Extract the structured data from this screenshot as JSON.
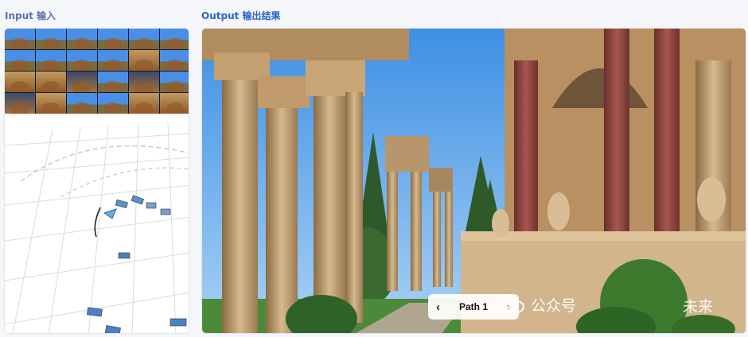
{
  "labels": {
    "input": "Input  输入",
    "output": "Output  输出结果"
  },
  "input_panel": {
    "thumbnail_count": 24,
    "camera_count": 9
  },
  "output_panel": {
    "path_control": {
      "prev_icon": "chevron-left-icon",
      "label": "Path 1",
      "next_icon": "chevron-right-icon"
    },
    "watermark": {
      "icon": "wechat-icon",
      "text": "公众号",
      "suffix": "未来"
    }
  },
  "colors": {
    "input_label": "#5b6fb4",
    "output_label": "#2a63c9",
    "sky": "#5da7ee",
    "stone": "#c8a77a",
    "column_red": "#9a4a42"
  }
}
